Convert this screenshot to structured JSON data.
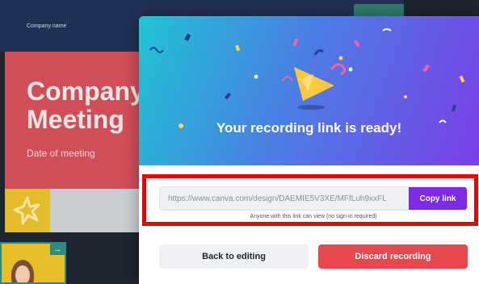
{
  "background_slide": {
    "company_name": "Company name",
    "title": "Company Meeting",
    "subtitle": "Date of meeting",
    "colors": {
      "header": "#223055",
      "panel": "#cf4e57",
      "tile": "#e3be2a",
      "footer": "#c9ccd1"
    },
    "thumbnail_icon": "arrow-right-icon"
  },
  "modal": {
    "hero_icon": "party-popper-icon",
    "title": "Your recording link is ready!",
    "link_url": "https://www.canva.com/design/DAEMIE5V3XE/MFfLuh9xxFL",
    "copy_button_label": "Copy link",
    "note": "Anyone with this link can view (no sign-in required)",
    "back_button_label": "Back to editing",
    "discard_button_label": "Discard recording",
    "colors": {
      "accent": "#7d2ae8",
      "danger": "#e5484d",
      "highlight_box": "#ee0000"
    }
  }
}
